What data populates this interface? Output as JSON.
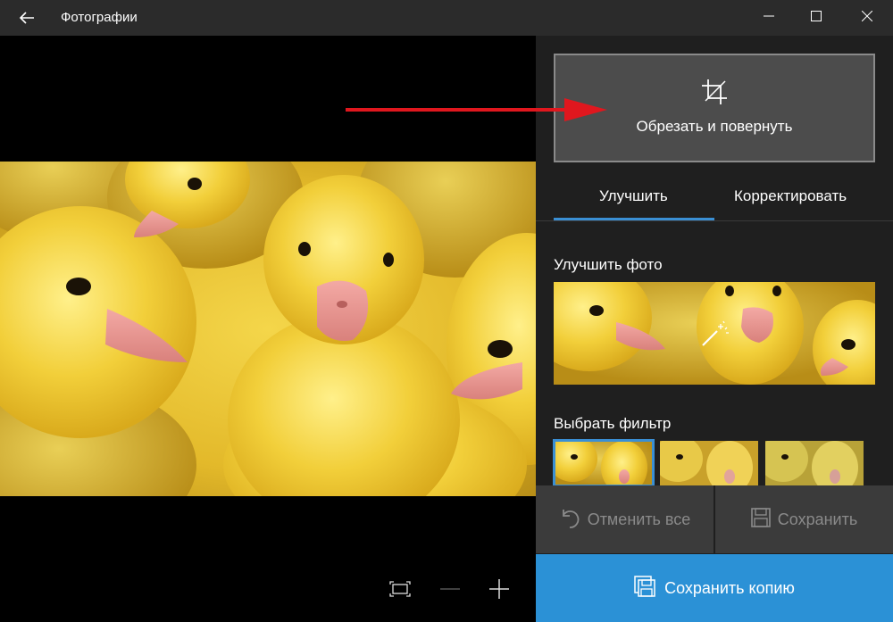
{
  "app": {
    "title": "Фотографии"
  },
  "icons": {
    "back": "back-arrow-icon",
    "minimize": "minimize-icon",
    "maximize": "maximize-icon",
    "close": "close-icon",
    "crop": "crop-icon",
    "magic_wand": "magic-wand-icon",
    "undo": "undo-icon",
    "save": "floppy-save-icon",
    "save_copy": "floppy-copy-icon",
    "fit": "fit-screen-icon",
    "zoom_out": "zoom-out-icon",
    "zoom_in": "zoom-in-icon"
  },
  "editor": {
    "crop_label": "Обрезать и повернуть",
    "tabs": [
      {
        "label": "Улучшить",
        "active": true
      },
      {
        "label": "Корректировать",
        "active": false
      }
    ],
    "enhance_title": "Улучшить фото",
    "filter_title": "Выбрать фильтр",
    "undo_label": "Отменить все",
    "save_label": "Сохранить",
    "save_copy_label": "Сохранить копию"
  },
  "colors": {
    "accent": "#2b91d6",
    "tab_underline": "#3a8fd4",
    "annotation_arrow": "#e0171e",
    "panel_bg": "#1f1f1f",
    "titlebar_bg": "#2b2b2b"
  }
}
